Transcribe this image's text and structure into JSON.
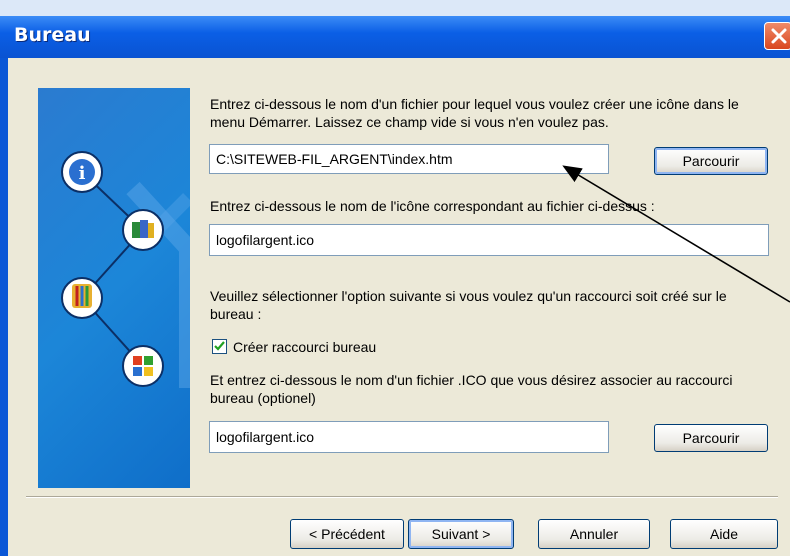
{
  "window": {
    "title": "Bureau",
    "close_icon": "close-icon"
  },
  "section1": {
    "instruction": "Entrez ci-dessous le nom d'un fichier pour lequel vous voulez créer une icône dans le menu Démarrer. Laissez ce champ vide si vous n'en voulez pas.",
    "file_value": "C:\\SITEWEB-FIL_ARGENT\\index.htm",
    "browse_label": "Parcourir"
  },
  "section2": {
    "instruction": "Entrez ci-dessous le nom de l'icône correspondant au fichier ci-dessus :",
    "icon_value": "logofilargent.ico"
  },
  "section3": {
    "instruction": "Veuillez sélectionner l'option suivante si vous voulez qu'un raccourci soit créé sur le bureau :",
    "checkbox_label": "Créer raccourci bureau",
    "checkbox_checked": true
  },
  "section4": {
    "instruction": "Et entrez ci-dessous le nom d'un fichier .ICO que vous désirez associer au raccourci bureau (optionel)",
    "ico_value": "logofilargent.ico",
    "browse_label": "Parcourir"
  },
  "footer": {
    "back_label": "< Précédent",
    "next_label": "Suivant >",
    "cancel_label": "Annuler",
    "help_label": "Aide"
  },
  "colors": {
    "titlebar": "#0a57d6",
    "dialog_bg": "#ece9d8",
    "side_panel": "#1c86d8"
  }
}
